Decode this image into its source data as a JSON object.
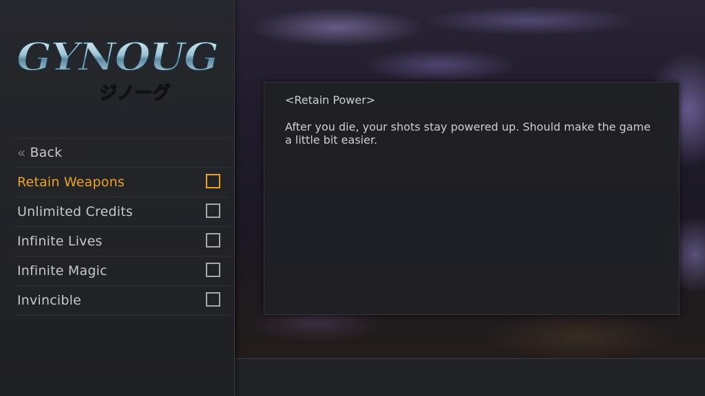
{
  "logo": {
    "title": "GYNOUG",
    "subtitle": "ジノーグ"
  },
  "menu": {
    "back": {
      "chevron": "«",
      "label": "Back"
    },
    "items": [
      {
        "label": "Retain Weapons",
        "checked": false,
        "selected": true
      },
      {
        "label": "Unlimited Credits",
        "checked": false,
        "selected": false
      },
      {
        "label": "Infinite Lives",
        "checked": false,
        "selected": false
      },
      {
        "label": "Infinite Magic",
        "checked": false,
        "selected": false
      },
      {
        "label": "Invincible",
        "checked": false,
        "selected": false
      }
    ]
  },
  "description": {
    "title": "<Retain Power>",
    "body": "After you die, your shots stay powered up. Should make the game a little bit easier."
  },
  "colors": {
    "accent": "#f0a31e",
    "text": "#c8c8cc",
    "panel": "#1f2024"
  }
}
